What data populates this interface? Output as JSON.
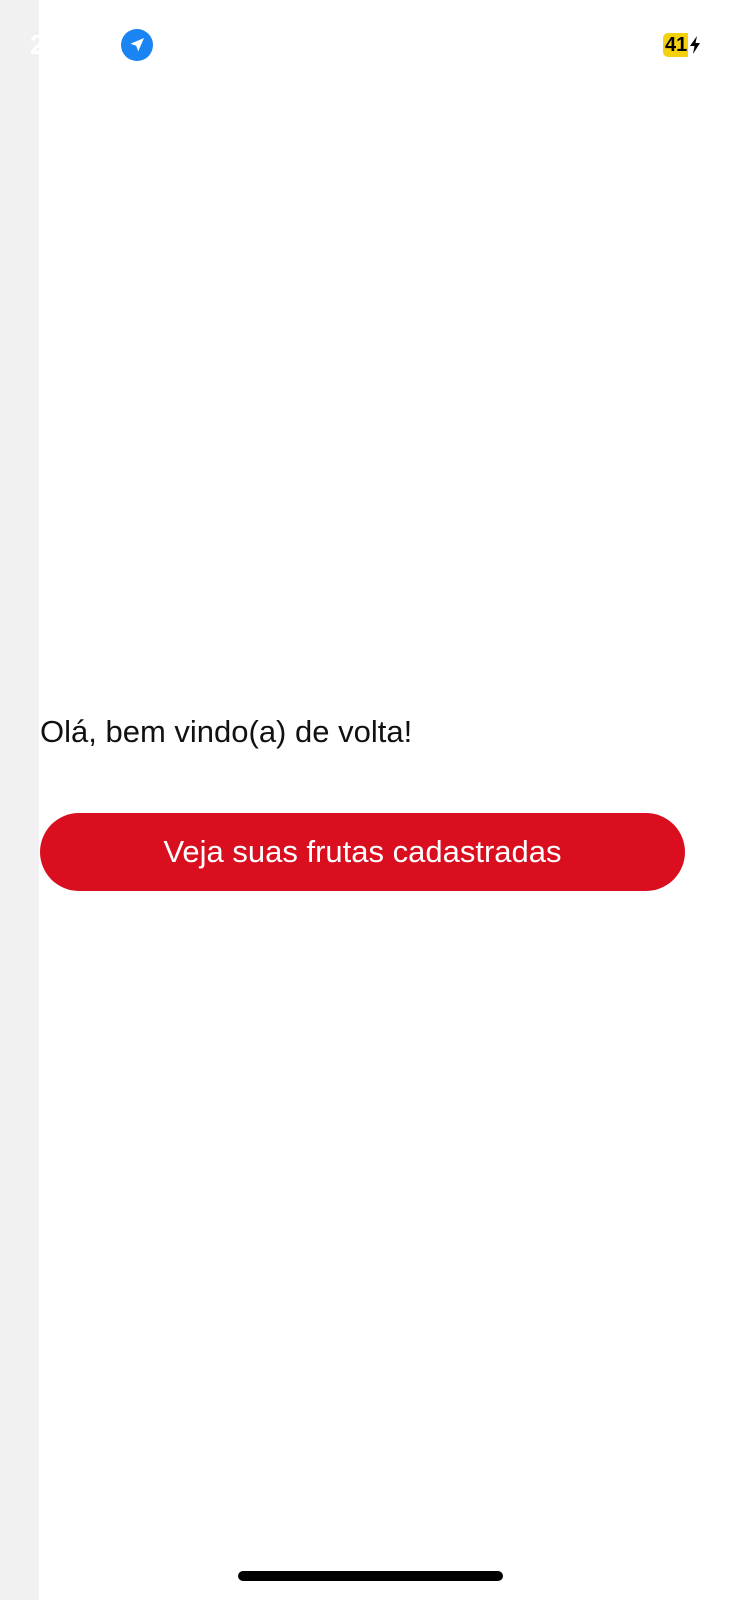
{
  "status_bar": {
    "time": "2",
    "battery_level": "41",
    "battery_badge_color": "#f5d10d",
    "location_icon": "location-arrow-icon",
    "location_icon_color": "#1a84f3",
    "charging_icon": "bolt-icon"
  },
  "main": {
    "greeting": "Olá, bem vindo(a) de volta!",
    "cta_label": "Veja suas frutas cadastradas",
    "accent_color": "#d90f1f"
  }
}
